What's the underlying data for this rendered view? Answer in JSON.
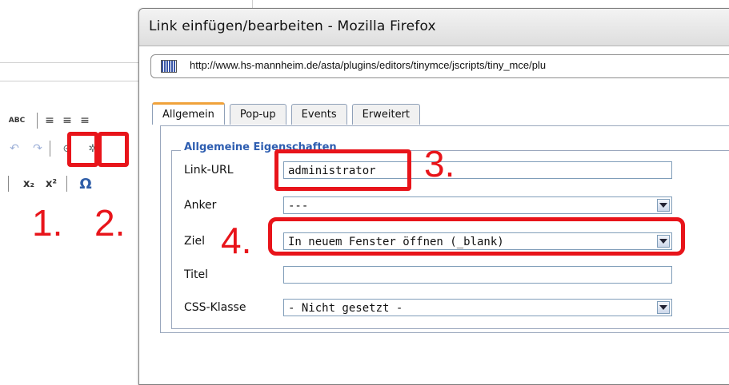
{
  "window": {
    "title": "Link einfügen/bearbeiten - Mozilla Firefox"
  },
  "urlbar": {
    "url": "http://www.hs-mannheim.de/asta/plugins/editors/tinymce/jscripts/tiny_mce/plu"
  },
  "tabs": [
    {
      "label": "Allgemein",
      "active": true
    },
    {
      "label": "Pop-up",
      "active": false
    },
    {
      "label": "Events",
      "active": false
    },
    {
      "label": "Erweitert",
      "active": false
    }
  ],
  "fieldset": {
    "legend": "Allgemeine Eigenschaften"
  },
  "form": {
    "link_url": {
      "label": "Link-URL",
      "value": "administrator"
    },
    "anker": {
      "label": "Anker",
      "value": "---"
    },
    "ziel": {
      "label": "Ziel",
      "value": "In neuem Fenster öffnen (_blank)"
    },
    "titel": {
      "label": "Titel",
      "value": ""
    },
    "css_klasse": {
      "label": "CSS-Klasse",
      "value": "- Nicht gesetzt -"
    }
  },
  "toolbar": {
    "spellcheck_label": "ABC",
    "subscript_label": "x₂",
    "superscript_label": "x²",
    "omega_label": "Ω"
  },
  "annotations": {
    "step1": "1.",
    "step2": "2.",
    "step3": "3.",
    "step4": "4."
  },
  "colors": {
    "highlight": "#e8141a",
    "legend": "#2d5db0",
    "tab_accent": "#f0a23b"
  }
}
